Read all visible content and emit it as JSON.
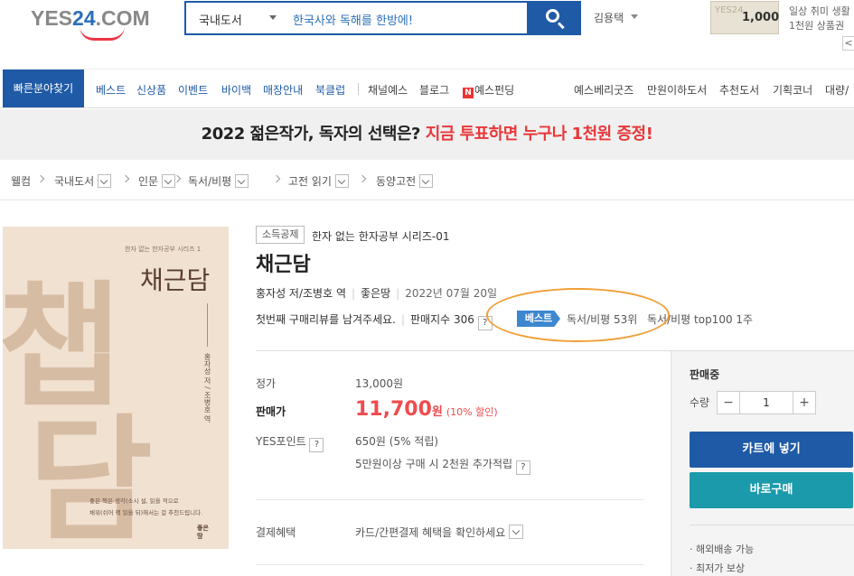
{
  "header": {
    "logo": {
      "prefix": "YES",
      "num": "24",
      "suffix": ".COM"
    },
    "search": {
      "category": "국내도서",
      "query": "한국사와 독해를 한방에!"
    },
    "user_name": "김용택",
    "promo": {
      "card_amount": "1,000",
      "card_bg": "YES24",
      "line1": "일상 취미 생활",
      "line2": "1천원 상품권",
      "prev": "<"
    }
  },
  "nav": {
    "quick": "빠른분야찾기",
    "items_left": [
      "베스트",
      "신상품",
      "이벤트",
      "바이백",
      "매장안내",
      "북클럽"
    ],
    "items_mid": [
      "채널예스",
      "블로그"
    ],
    "n_icon": "N",
    "funding": "예스펀딩",
    "items_right": [
      "예스베리굿즈",
      "만원이하도서",
      "추천도서",
      "기획코너",
      "대량/"
    ]
  },
  "banner": {
    "text": "2022 젊은작가, 독자의 선택은? ",
    "highlight": "지금 투표하면 누구나 1천원 증정!"
  },
  "breadcrumb": [
    "웰컴",
    "국내도서",
    "인문",
    "독서/비평",
    "고전 읽기",
    "동양고전"
  ],
  "cover": {
    "big1": "챕",
    "big2": "담",
    "series": "한자 없는 한자공부 시리즈 1",
    "title": "채근담",
    "author": "홍자성 저 / 조병호 역",
    "blurb1": "좋은 책은 생각(소시 설, 읽을 적으로",
    "blurb2": "채워(쉬어 책 읽을 뒤)해서는 걸 추천드립니다.",
    "publisher": "좋은 땅"
  },
  "product": {
    "badge": "소득공제",
    "series": "한자 없는 한자공부 시리즈-01",
    "title": "채근담",
    "authors": "홍자성 저/조병호 역",
    "publisher": "좋은땅",
    "date": "2022년 07월 20일",
    "review": "첫번째 구매리뷰를 남겨주세요.",
    "sales_index": "판매지수 306",
    "q": "?",
    "best_tag": "베스트",
    "rank1": "독서/비평 53위",
    "rank2": "독서/비평 top100 1주"
  },
  "price": {
    "list_label": "정가",
    "list_value": "13,000원",
    "sale_label": "판매가",
    "sale_value": "11,700",
    "sale_unit": "원",
    "discount": "(10% 할인)",
    "point_label": "YES포인트",
    "point_value": "650원 (5% 적립)",
    "point_extra": "5만원이상 구매 시 2천원 추가적립",
    "pay_label": "결제혜택",
    "pay_value": "카드/간편결제 혜택을 확인하세요"
  },
  "buy": {
    "status": "판매중",
    "qty_label": "수량",
    "qty": "1",
    "minus": "−",
    "plus": "+",
    "cart": "카트에 넣기",
    "buy_now": "바로구매",
    "benefits": [
      "· 해외배송 가능",
      "· 최저가 보상"
    ]
  }
}
